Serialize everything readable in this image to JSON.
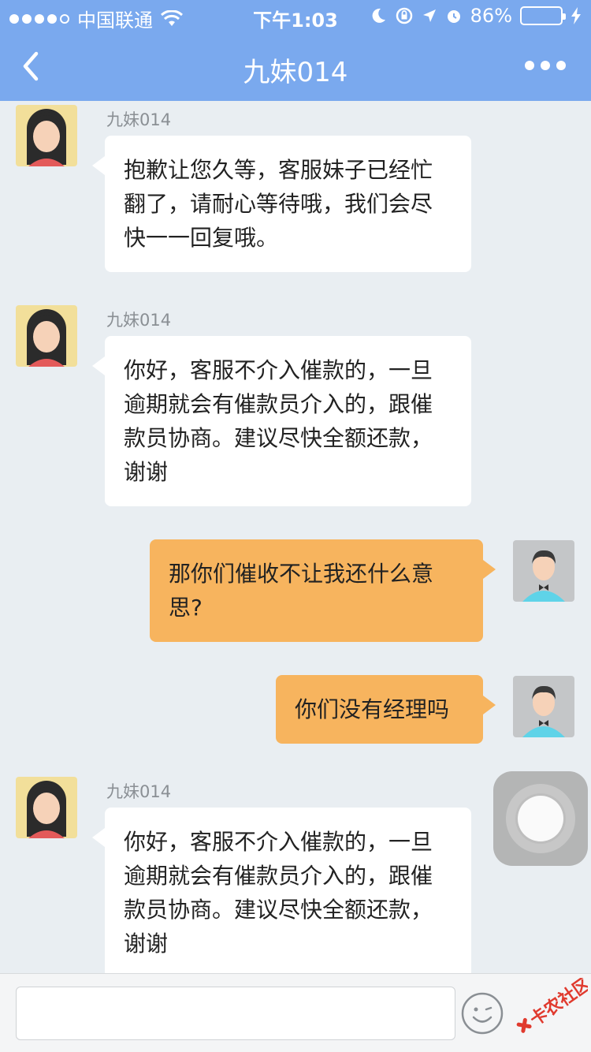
{
  "status_bar": {
    "carrier": "中国联通",
    "time": "下午1:03",
    "battery_percent": "86%",
    "battery_level": 0.86
  },
  "nav": {
    "title": "九妹014"
  },
  "messages": [
    {
      "sender": "九妹014",
      "side": "left",
      "text": "抱歉让您久等，客服妹子已经忙翻了，请耐心等待哦，我们会尽快一一回复哦。"
    },
    {
      "sender": "九妹014",
      "side": "left",
      "text": "你好，客服不介入催款的，一旦逾期就会有催款员介入的，跟催款员协商。建议尽快全额还款，谢谢"
    },
    {
      "side": "right",
      "text": "那你们催收不让我还什么意思?"
    },
    {
      "side": "right",
      "text": "你们没有经理吗"
    },
    {
      "sender": "九妹014",
      "side": "left",
      "text": "你好，客服不介入催款的，一旦逾期就会有催款员介入的，跟催款员协商。建议尽快全额还款，谢谢"
    }
  ],
  "input": {
    "placeholder": ""
  },
  "watermark": {
    "text": "卡农社区"
  },
  "colors": {
    "nav_bg": "#7aa9ee",
    "chat_bg": "#e9eef2",
    "incoming_bubble": "#ffffff",
    "outgoing_bubble": "#f7b45e"
  }
}
